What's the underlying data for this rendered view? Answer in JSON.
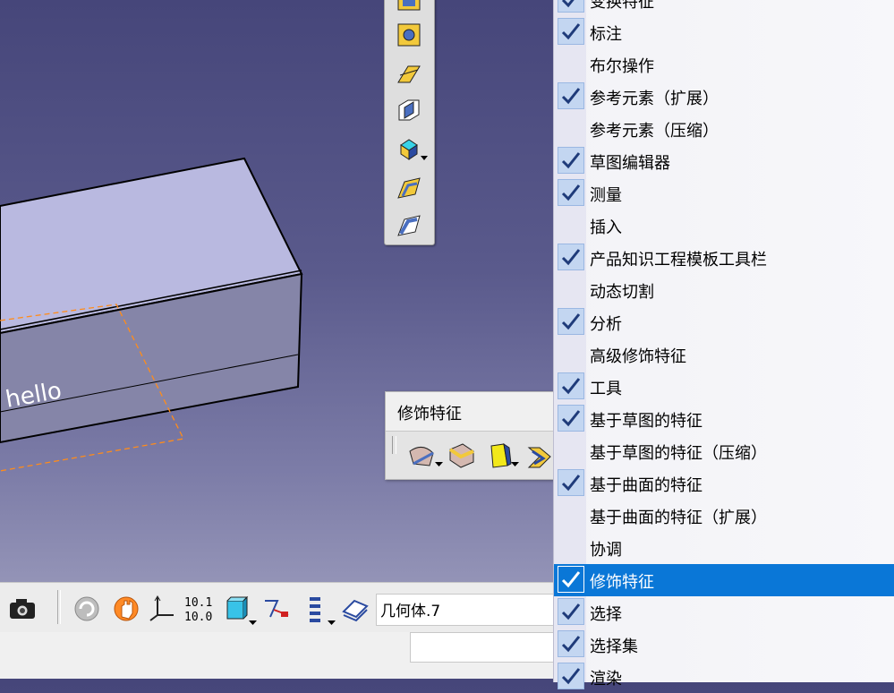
{
  "viewport": {
    "model_text": "hello"
  },
  "floating_toolbar": {
    "title": "修饰特征",
    "tools": [
      "fillet-icon",
      "variable-fillet-icon",
      "draft-icon",
      "shell-icon"
    ]
  },
  "vertical_toolbar": {
    "tools": [
      "pocket-icon",
      "hole-icon",
      "rib-icon",
      "slot-icon",
      "solid-combine-icon",
      "multi-section-icon",
      "removed-multi-section-icon"
    ]
  },
  "bottom_toolbar": {
    "tools": [
      "capture-icon",
      "update-icon",
      "manipulate-icon",
      "axis-icon",
      "measure-icon",
      "cube-icon",
      "constraint-icon",
      "tree-icon",
      "layer-icon"
    ],
    "geometry_field": "几何体.7"
  },
  "context_menu": {
    "items": [
      {
        "label": "变换特征",
        "checked": true
      },
      {
        "label": "标注",
        "checked": true
      },
      {
        "label": "布尔操作",
        "checked": false
      },
      {
        "label": "参考元素（扩展）",
        "checked": true
      },
      {
        "label": "参考元素（压缩）",
        "checked": false
      },
      {
        "label": "草图编辑器",
        "checked": true
      },
      {
        "label": "测量",
        "checked": true
      },
      {
        "label": "插入",
        "checked": false
      },
      {
        "label": "产品知识工程模板工具栏",
        "checked": true
      },
      {
        "label": "动态切割",
        "checked": false
      },
      {
        "label": "分析",
        "checked": true
      },
      {
        "label": "高级修饰特征",
        "checked": false
      },
      {
        "label": "工具",
        "checked": true
      },
      {
        "label": "基于草图的特征",
        "checked": true
      },
      {
        "label": "基于草图的特征（压缩）",
        "checked": false
      },
      {
        "label": "基于曲面的特征",
        "checked": true
      },
      {
        "label": "基于曲面的特征（扩展）",
        "checked": false
      },
      {
        "label": "协调",
        "checked": false
      },
      {
        "label": "修饰特征",
        "checked": true,
        "highlighted": true
      },
      {
        "label": "选择",
        "checked": true
      },
      {
        "label": "选择集",
        "checked": true
      },
      {
        "label": "渲染",
        "checked": true
      }
    ],
    "highlight_color": "#0a77d7"
  }
}
